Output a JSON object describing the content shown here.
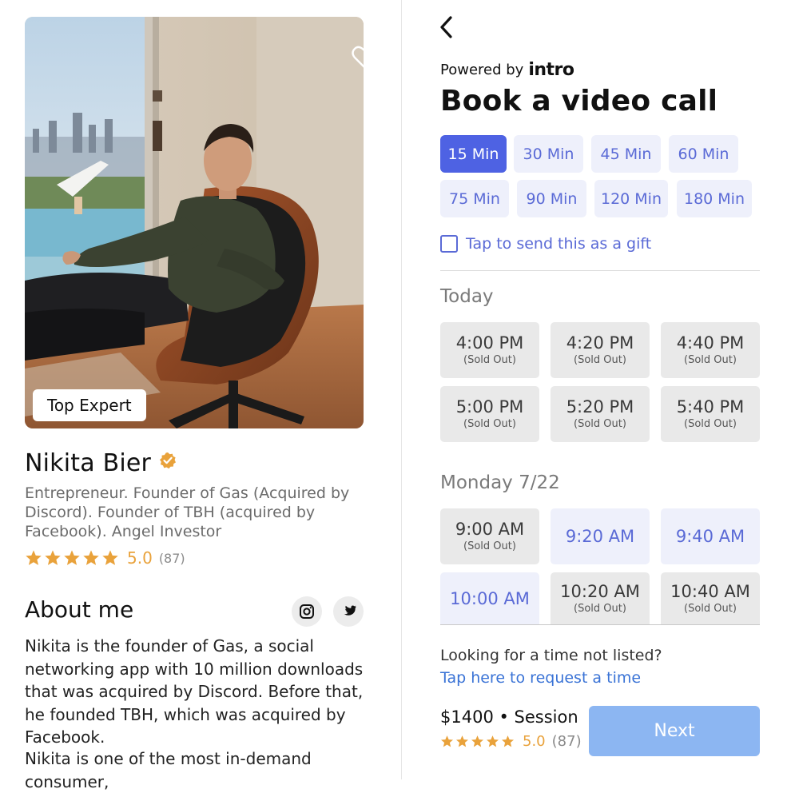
{
  "profile": {
    "badge": "Top Expert",
    "name": "Nikita Bier",
    "bio": "Entrepreneur. Founder of Gas (Acquired by Discord). Founder of TBH (acquired by Facebook). Angel Investor",
    "rating": "5.0",
    "rating_count": "(87)",
    "stars": 5
  },
  "about": {
    "title": "About me",
    "paragraphs": [
      "Nikita is the founder of Gas, a social networking app with 10 million downloads that was acquired by Discord. Before that, he founded TBH, which was acquired by Facebook.",
      "Nikita is one of the most in-demand consumer,"
    ]
  },
  "booking": {
    "powered_by": "Powered by",
    "brand": "intro",
    "title": "Book a video call",
    "durations": [
      {
        "label": "15 Min",
        "active": true
      },
      {
        "label": "30 Min",
        "active": false
      },
      {
        "label": "45 Min",
        "active": false
      },
      {
        "label": "60 Min",
        "active": false
      },
      {
        "label": "75 Min",
        "active": false
      },
      {
        "label": "90 Min",
        "active": false
      },
      {
        "label": "120 Min",
        "active": false
      },
      {
        "label": "180 Min",
        "active": false
      }
    ],
    "gift_label": "Tap to send this as a gift",
    "days": [
      {
        "label": "Today",
        "slots": [
          {
            "time": "4:00 PM",
            "status": "(Sold Out)"
          },
          {
            "time": "4:20 PM",
            "status": "(Sold Out)"
          },
          {
            "time": "4:40 PM",
            "status": "(Sold Out)"
          },
          {
            "time": "5:00 PM",
            "status": "(Sold Out)"
          },
          {
            "time": "5:20 PM",
            "status": "(Sold Out)"
          },
          {
            "time": "5:40 PM",
            "status": "(Sold Out)"
          }
        ]
      },
      {
        "label": "Monday 7/22",
        "slots": [
          {
            "time": "9:00 AM",
            "status": "(Sold Out)"
          },
          {
            "time": "9:20 AM",
            "status": ""
          },
          {
            "time": "9:40 AM",
            "status": ""
          },
          {
            "time": "10:00 AM",
            "status": ""
          },
          {
            "time": "10:20 AM",
            "status": "(Sold Out)"
          },
          {
            "time": "10:40 AM",
            "status": "(Sold Out)"
          }
        ]
      }
    ],
    "looking_text": "Looking for a time not listed?",
    "request_link": "Tap here to request a time",
    "price": "$1400 • Session",
    "rating": "5.0",
    "rating_count": "(87)",
    "next_label": "Next"
  },
  "colors": {
    "accent": "#4e62e3",
    "accent_light": "#eef0fb",
    "star": "#e9a23b",
    "link": "#3a73d6",
    "next_button": "#8cb6f2"
  },
  "icons": [
    "heart-icon",
    "verified-icon",
    "star-icon",
    "instagram-icon",
    "twitter-icon",
    "back-arrow-icon",
    "checkbox-icon"
  ]
}
